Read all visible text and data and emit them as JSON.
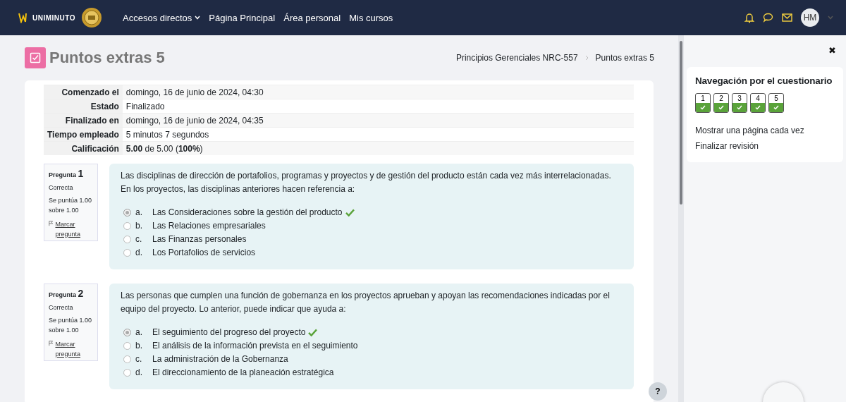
{
  "navbar": {
    "logo_text": "UNIMINUTO",
    "links": [
      {
        "label": "Accesos directos",
        "dropdown": true
      },
      {
        "label": "Página Principal",
        "dropdown": false
      },
      {
        "label": "Área personal",
        "dropdown": false
      },
      {
        "label": "Mis cursos",
        "dropdown": false
      }
    ],
    "avatar": "HM"
  },
  "page": {
    "title": "Puntos extras 5",
    "breadcrumb": [
      "Principios Gerenciales NRC-557",
      "Puntos extras 5"
    ]
  },
  "summary": [
    {
      "label": "Comenzado el",
      "value": "domingo, 16 de junio de 2024, 04:30"
    },
    {
      "label": "Estado",
      "value": "Finalizado"
    },
    {
      "label": "Finalizado en",
      "value": "domingo, 16 de junio de 2024, 04:35"
    },
    {
      "label": "Tiempo empleado",
      "value": "5 minutos 7 segundos"
    },
    {
      "label": "Calificación",
      "value": "**5.00** de 5.00 (**100%**)"
    }
  ],
  "questions": [
    {
      "label": "Pregunta",
      "number": "1",
      "status": "Correcta",
      "score": "Se puntúa 1.00 sobre 1.00",
      "flag": "Marcar pregunta",
      "text": "Las disciplinas de dirección de portafolios, programas y proyectos y de gestión del producto están cada vez más interrelacionadas. En los proyectos, las disciplinas anteriores hacen referencia a:",
      "options": [
        {
          "letter": "a.",
          "text": "Las Consideraciones sobre la gestión del producto",
          "selected": true,
          "correct": true
        },
        {
          "letter": "b.",
          "text": "Las Relaciones empresariales",
          "selected": false,
          "correct": false
        },
        {
          "letter": "c.",
          "text": "Las Finanzas personales",
          "selected": false,
          "correct": false
        },
        {
          "letter": "d.",
          "text": "Los Portafolios de servicios",
          "selected": false,
          "correct": false
        }
      ]
    },
    {
      "label": "Pregunta",
      "number": "2",
      "status": "Correcta",
      "score": "Se puntúa 1.00 sobre 1.00",
      "flag": "Marcar pregunta",
      "text": "Las personas que cumplen una función de gobernanza en los proyectos aprueban y apoyan las recomendaciones indicadas por el equipo del proyecto. Lo anterior, puede indicar que ayuda a:",
      "options": [
        {
          "letter": "a.",
          "text": "El seguimiento del progreso del proyecto",
          "selected": true,
          "correct": true
        },
        {
          "letter": "b.",
          "text": "El análisis de la información prevista en el seguimiento",
          "selected": false,
          "correct": false
        },
        {
          "letter": "c.",
          "text": "La administración de la Gobernanza",
          "selected": false,
          "correct": false
        },
        {
          "letter": "d.",
          "text": "El direccionamiento de la planeación estratégica",
          "selected": false,
          "correct": false
        }
      ]
    }
  ],
  "help_button": "?",
  "drawer": {
    "close": "✖",
    "title": "Navegación por el cuestionario",
    "nav_buttons": [
      {
        "label": "1",
        "correct": true
      },
      {
        "label": "2",
        "correct": true
      },
      {
        "label": "3",
        "correct": true
      },
      {
        "label": "4",
        "correct": true
      },
      {
        "label": "5",
        "correct": true
      }
    ],
    "links": [
      "Mostrar una página cada vez",
      "Finalizar revisión"
    ]
  }
}
